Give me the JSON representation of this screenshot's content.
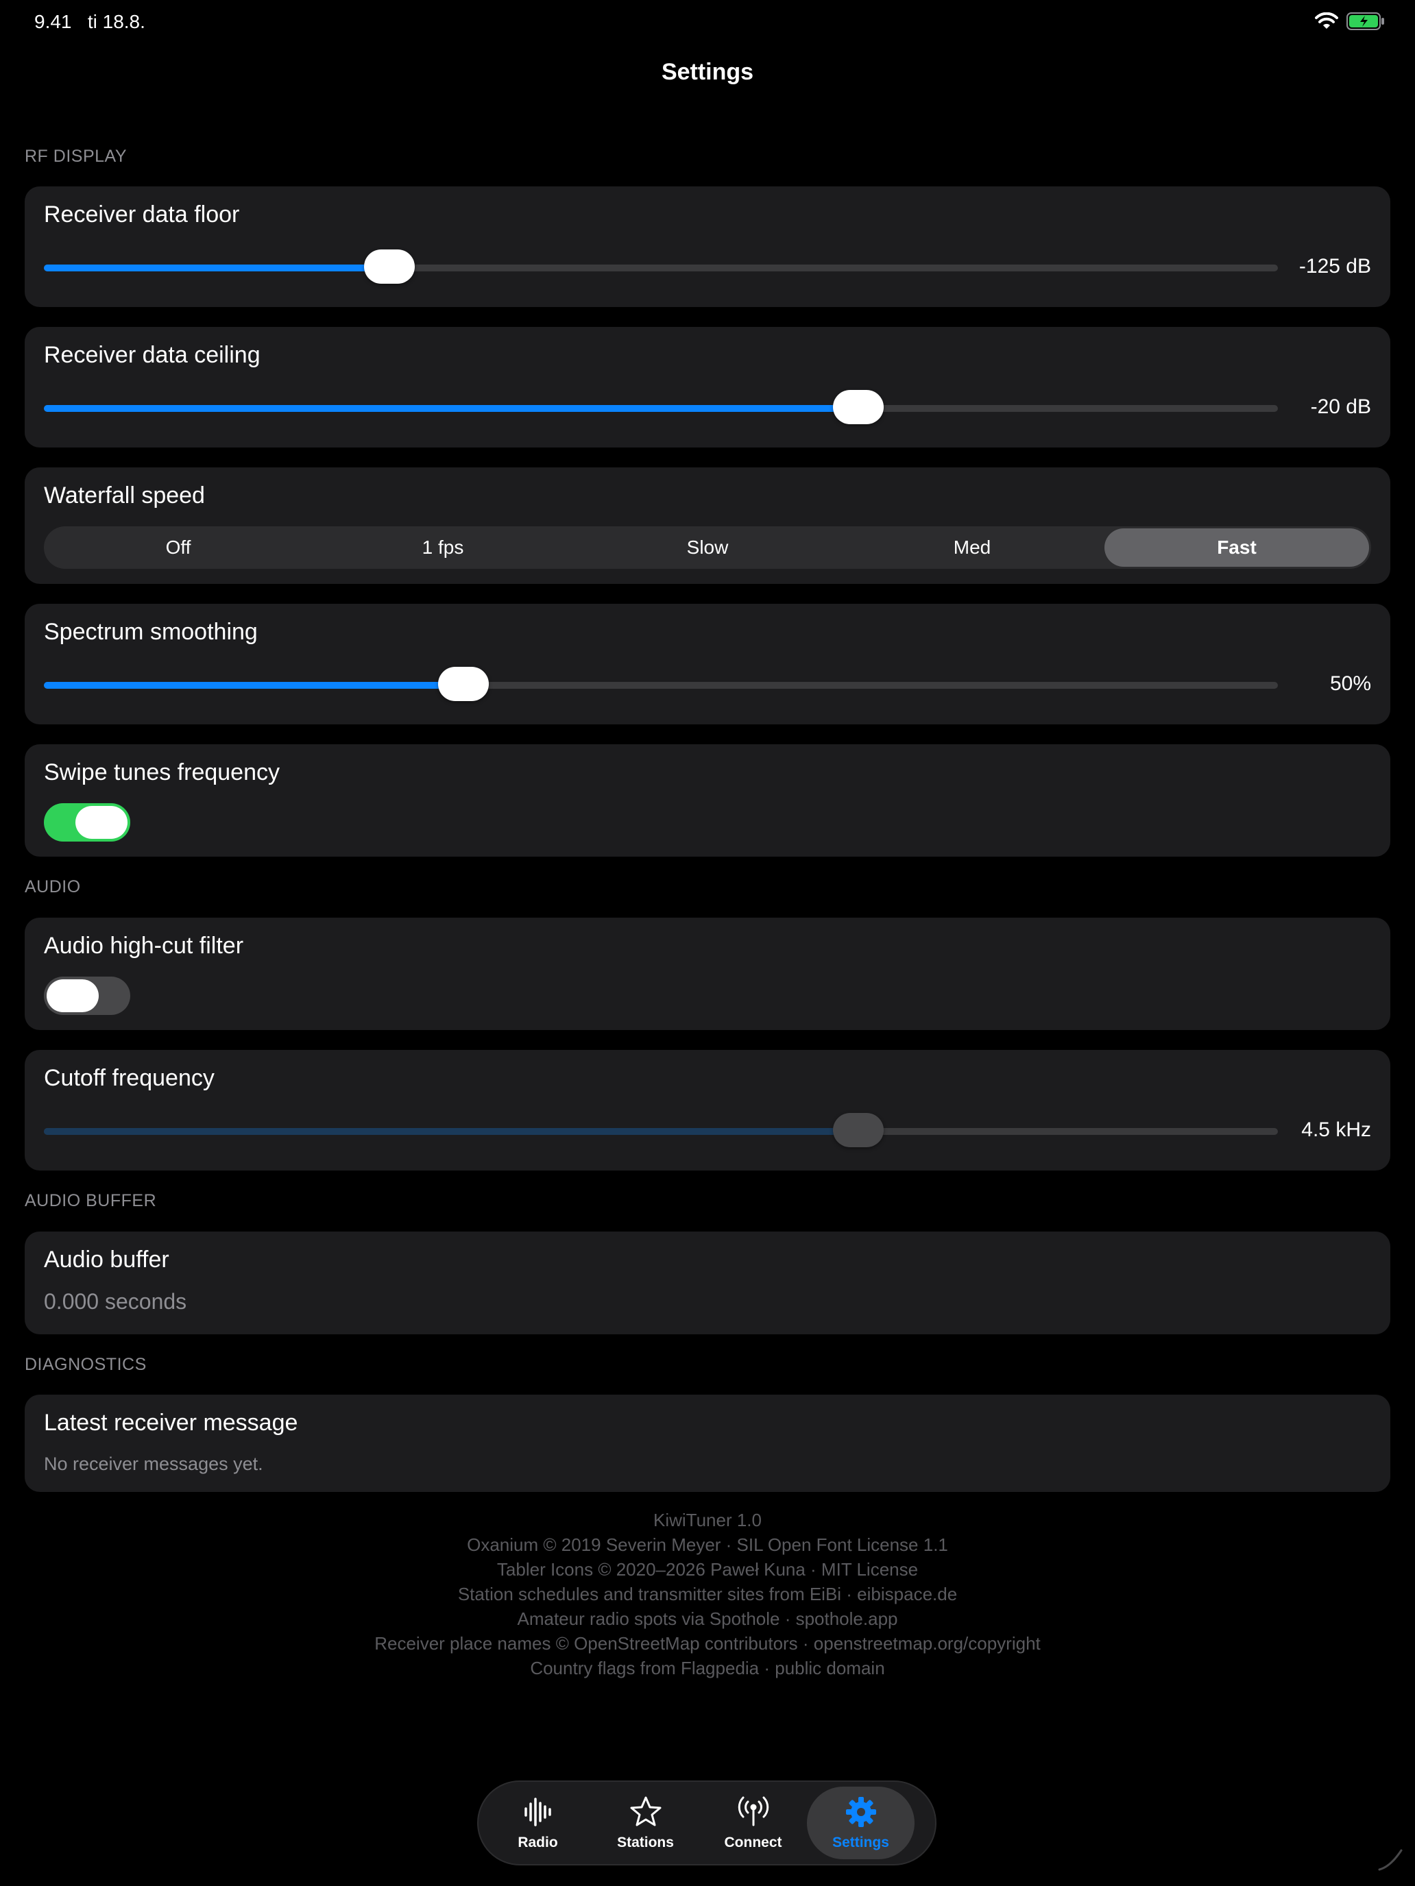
{
  "status_bar": {
    "time": "9.41",
    "date": "ti 18.8."
  },
  "nav": {
    "title": "Settings"
  },
  "sections": {
    "rf_display": "RF DISPLAY",
    "audio": "AUDIO",
    "audio_buffer": "AUDIO BUFFER",
    "diagnostics": "DIAGNOSTICS"
  },
  "receiver_floor": {
    "label": "Receiver data floor",
    "value": "-125 dB",
    "fraction": 0.28
  },
  "receiver_ceiling": {
    "label": "Receiver data ceiling",
    "value": "-20 dB",
    "fraction": 0.66
  },
  "waterfall": {
    "label": "Waterfall speed",
    "options": [
      "Off",
      "1 fps",
      "Slow",
      "Med",
      "Fast"
    ],
    "selected": "Fast"
  },
  "spectrum": {
    "label": "Spectrum smoothing",
    "value": "50%",
    "fraction": 0.34
  },
  "swipe": {
    "label": "Swipe tunes frequency",
    "on": true
  },
  "highcut": {
    "label": "Audio high-cut filter",
    "on": false
  },
  "cutoff": {
    "label": "Cutoff frequency",
    "value": "4.5 kHz",
    "fraction": 0.66
  },
  "buffer": {
    "label": "Audio buffer",
    "value": "0.000 seconds"
  },
  "diag": {
    "label": "Latest receiver message",
    "value": "No receiver messages yet."
  },
  "footer": [
    "KiwiTuner 1.0",
    "Oxanium © 2019 Severin Meyer · SIL Open Font License 1.1",
    "Tabler Icons © 2020–2026 Paweł Kuna · MIT License",
    "Station schedules and transmitter sites from EiBi · eibispace.de",
    "Amateur radio spots via Spothole · spothole.app",
    "Receiver place names © OpenStreetMap contributors · openstreetmap.org/copyright",
    "Country flags from Flagpedia · public domain"
  ],
  "tabs": [
    {
      "label": "Radio",
      "icon": "waveform-icon"
    },
    {
      "label": "Stations",
      "icon": "star-icon"
    },
    {
      "label": "Connect",
      "icon": "antenna-icon"
    },
    {
      "label": "Settings",
      "icon": "gear-icon",
      "active": true
    }
  ],
  "colors": {
    "accent": "#0a84ff",
    "toggle_on": "#30d158",
    "card": "#1c1c1e"
  }
}
